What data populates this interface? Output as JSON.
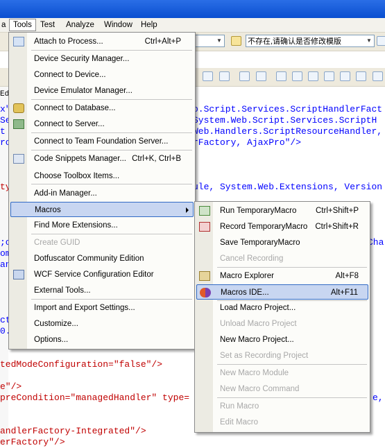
{
  "menubar": {
    "items": [
      {
        "label": "a"
      },
      {
        "label": "Tools"
      },
      {
        "label": "Test"
      },
      {
        "label": "Analyze"
      },
      {
        "label": "Window"
      },
      {
        "label": "Help"
      }
    ]
  },
  "toolbar": {
    "combo_text": "不存在,请确认是否修改模版"
  },
  "editor": {
    "tab_fragment": "Ed"
  },
  "tools_menu": {
    "items": [
      {
        "label": "Attach to Process...",
        "shortcut": "Ctrl+Alt+P",
        "icon": "attach-process-icon"
      },
      {
        "label": "Device Security Manager...",
        "shortcut": "",
        "icon": ""
      },
      {
        "label": "Connect to Device...",
        "shortcut": "",
        "icon": ""
      },
      {
        "label": "Device Emulator Manager...",
        "shortcut": "",
        "icon": ""
      },
      {
        "label": "Connect to Database...",
        "shortcut": "",
        "icon": "connect-database-icon"
      },
      {
        "label": "Connect to Server...",
        "shortcut": "",
        "icon": "connect-server-icon"
      },
      {
        "label": "Connect to Team Foundation Server...",
        "shortcut": "",
        "icon": ""
      },
      {
        "label": "Code Snippets Manager...",
        "shortcut": "Ctrl+K, Ctrl+B",
        "icon": "code-snippets-icon"
      },
      {
        "label": "Choose Toolbox Items...",
        "shortcut": "",
        "icon": ""
      },
      {
        "label": "Add-in Manager...",
        "shortcut": "",
        "icon": ""
      },
      {
        "label": "Macros",
        "shortcut": "",
        "icon": ""
      },
      {
        "label": "Find More Extensions...",
        "shortcut": "",
        "icon": ""
      },
      {
        "label": "Create GUID",
        "shortcut": "",
        "icon": ""
      },
      {
        "label": "Dotfuscator Community Edition",
        "shortcut": "",
        "icon": ""
      },
      {
        "label": "WCF Service Configuration Editor",
        "shortcut": "",
        "icon": "wcf-config-icon"
      },
      {
        "label": "External Tools...",
        "shortcut": "",
        "icon": ""
      },
      {
        "label": "Import and Export Settings...",
        "shortcut": "",
        "icon": ""
      },
      {
        "label": "Customize...",
        "shortcut": "",
        "icon": ""
      },
      {
        "label": "Options...",
        "shortcut": "",
        "icon": ""
      }
    ]
  },
  "macros_menu": {
    "items": [
      {
        "label": "Run TemporaryMacro",
        "shortcut": "Ctrl+Shift+P"
      },
      {
        "label": "Record TemporaryMacro",
        "shortcut": "Ctrl+Shift+R"
      },
      {
        "label": "Save TemporaryMacro",
        "shortcut": ""
      },
      {
        "label": "Cancel Recording",
        "shortcut": ""
      },
      {
        "label": "Macro Explorer",
        "shortcut": "Alt+F8"
      },
      {
        "label": "Macros IDE...",
        "shortcut": "Alt+F11"
      },
      {
        "label": "Load Macro Project...",
        "shortcut": ""
      },
      {
        "label": "Unload Macro Project",
        "shortcut": ""
      },
      {
        "label": "New Macro Project...",
        "shortcut": ""
      },
      {
        "label": "Set as Recording Project",
        "shortcut": ""
      },
      {
        "label": "New Macro Module",
        "shortcut": ""
      },
      {
        "label": "New Macro Command",
        "shortcut": ""
      },
      {
        "label": "Run Macro",
        "shortcut": ""
      },
      {
        "label": "Edit Macro",
        "shortcut": ""
      }
    ]
  },
  "code_fragments": {
    "l1": "o.Script.Services.ScriptHandlerFact",
    "l2_quote": "\"",
    "l2": "System.Web.Script.Services.ScriptH",
    "l3": "Web.Handlers.ScriptResourceHandler,",
    "l4": "rFactory, AjaxPro\"/>",
    "l5": "ule, System.Web.Extensions, Version",
    "l6a": "x\"",
    "l6b": "Se",
    "l6c": "t",
    "l6d": "ro",
    "l7": "ty",
    "l8": ";c",
    "l9": "om",
    "l10": "an",
    "l11": "ct",
    "l12": "0.",
    "l13": "Char",
    "l14": "tedModeConfiguration=\"false\"/>",
    "l15": "e\"/>",
    "l16": "preCondition=\"managedHandler\" type=",
    "l16b": "e,",
    "l17": "andlerFactory-Integrated\"/>",
    "l18": "erFactory\"/>"
  }
}
